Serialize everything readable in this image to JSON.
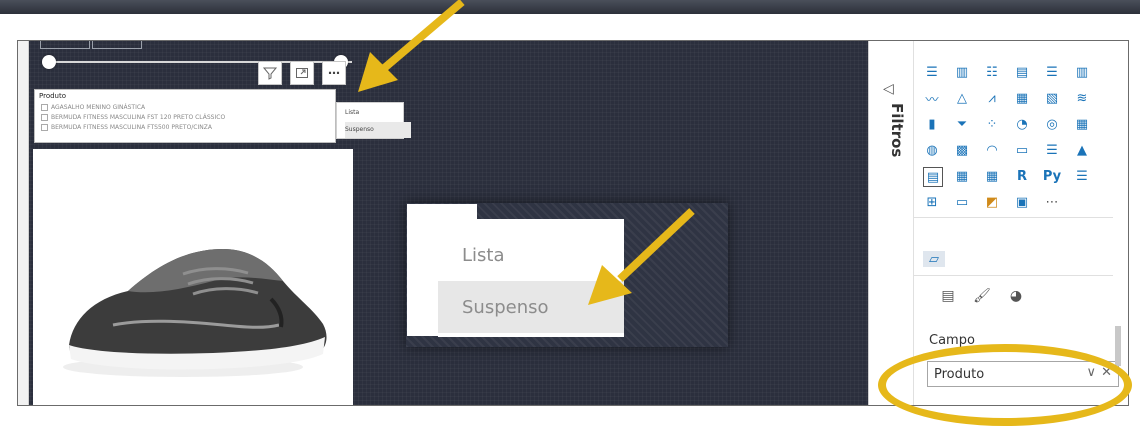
{
  "slicer": {
    "title": "Produto",
    "items": [
      "AGASALHO MENINO GINÁSTICA",
      "BERMUDA FITNESS MASCULINA FST 120 PRETO CLÁSSICO",
      "BERMUDA FITNESS MASCULINA FTS500 PRETO/CINZA"
    ]
  },
  "mini_menu": {
    "options": [
      "Lista",
      "Suspenso"
    ]
  },
  "big_menu": {
    "options": [
      "Lista",
      "Suspenso"
    ]
  },
  "filters_panel": {
    "label": "Filtros"
  },
  "field_well": {
    "label": "Campo",
    "value": "Produto"
  },
  "colors": {
    "canvas": "#2b2f3d",
    "annotation": "#e6b81a",
    "icon_blue": "#1a73b8"
  }
}
